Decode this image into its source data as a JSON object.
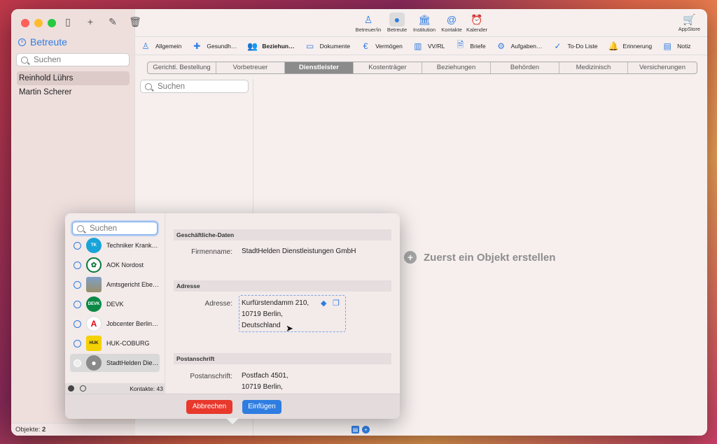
{
  "sidebar": {
    "title": "Betreute",
    "search_placeholder": "Suchen",
    "items": [
      "Reinhold Lührs",
      "Martin Scherer"
    ],
    "status_label": "Objekte:",
    "status_count": "2"
  },
  "toolbar": {
    "items": [
      {
        "label": "Betreuer/in",
        "icon": "supervisor-icon"
      },
      {
        "label": "Betreute",
        "icon": "person-icon"
      },
      {
        "label": "Institution",
        "icon": "institution-icon"
      },
      {
        "label": "Kontakte",
        "icon": "contacts-icon"
      },
      {
        "label": "Kalender",
        "icon": "alarm-clock-icon"
      }
    ],
    "appstore_label": "AppStore"
  },
  "tabs": [
    "Allgemein",
    "Gesundh…",
    "Beziehun…",
    "Dokumente",
    "Vermögen",
    "VV/RL",
    "Briefe",
    "Aufgaben…",
    "To-Do Liste",
    "Erinnerung",
    "Notiz"
  ],
  "segments": [
    "Gerichtl. Bestellung",
    "Vorbetreuer",
    "Dienstleister",
    "Kostenträger",
    "Beziehungen",
    "Behörden",
    "Medizinisch",
    "Versicherungen"
  ],
  "list_search_placeholder": "Suchen",
  "empty_message": "Zuerst ein Objekt erstellen",
  "popover": {
    "search_placeholder": "Suchen",
    "contacts": [
      {
        "name": "Techniker Krank…",
        "logo_text": "TK",
        "color": "#18a4d8"
      },
      {
        "name": "AOK Nordost",
        "logo_text": "AOK",
        "color": "#0b7a3c"
      },
      {
        "name": "Amtsgericht Ebe…",
        "logo_text": "",
        "color": "#9a8f6a"
      },
      {
        "name": "DEVK",
        "logo_text": "DEVK",
        "color": "#0a8a46"
      },
      {
        "name": "Jobcenter Berlin…",
        "logo_text": "A",
        "color": "#e30613"
      },
      {
        "name": "HUK-COBURG",
        "logo_text": "HUK",
        "color": "#f4d100"
      },
      {
        "name": "StadtHelden Die…",
        "logo_text": "",
        "color": "#8a8a8a"
      }
    ],
    "footer_label": "Kontakte:",
    "footer_count": "43",
    "sections": {
      "business": "Geschäftliche-Daten",
      "address": "Adresse",
      "postal": "Postanschrift"
    },
    "company_label": "Firmenname:",
    "company_value": "StadtHelden Dienstleistungen GmbH",
    "address_label": "Adresse:",
    "address_lines": [
      "Kurfürstendamm 210,",
      "10719 Berlin,",
      "Deutschland"
    ],
    "postal_label": "Postanschrift:",
    "postal_lines": [
      "Postfach 4501,",
      "10719 Berlin,"
    ],
    "cancel_label": "Abbrechen",
    "insert_label": "Einfügen"
  },
  "colors": {
    "accent": "#2f7de1",
    "cancel": "#e8392c"
  }
}
